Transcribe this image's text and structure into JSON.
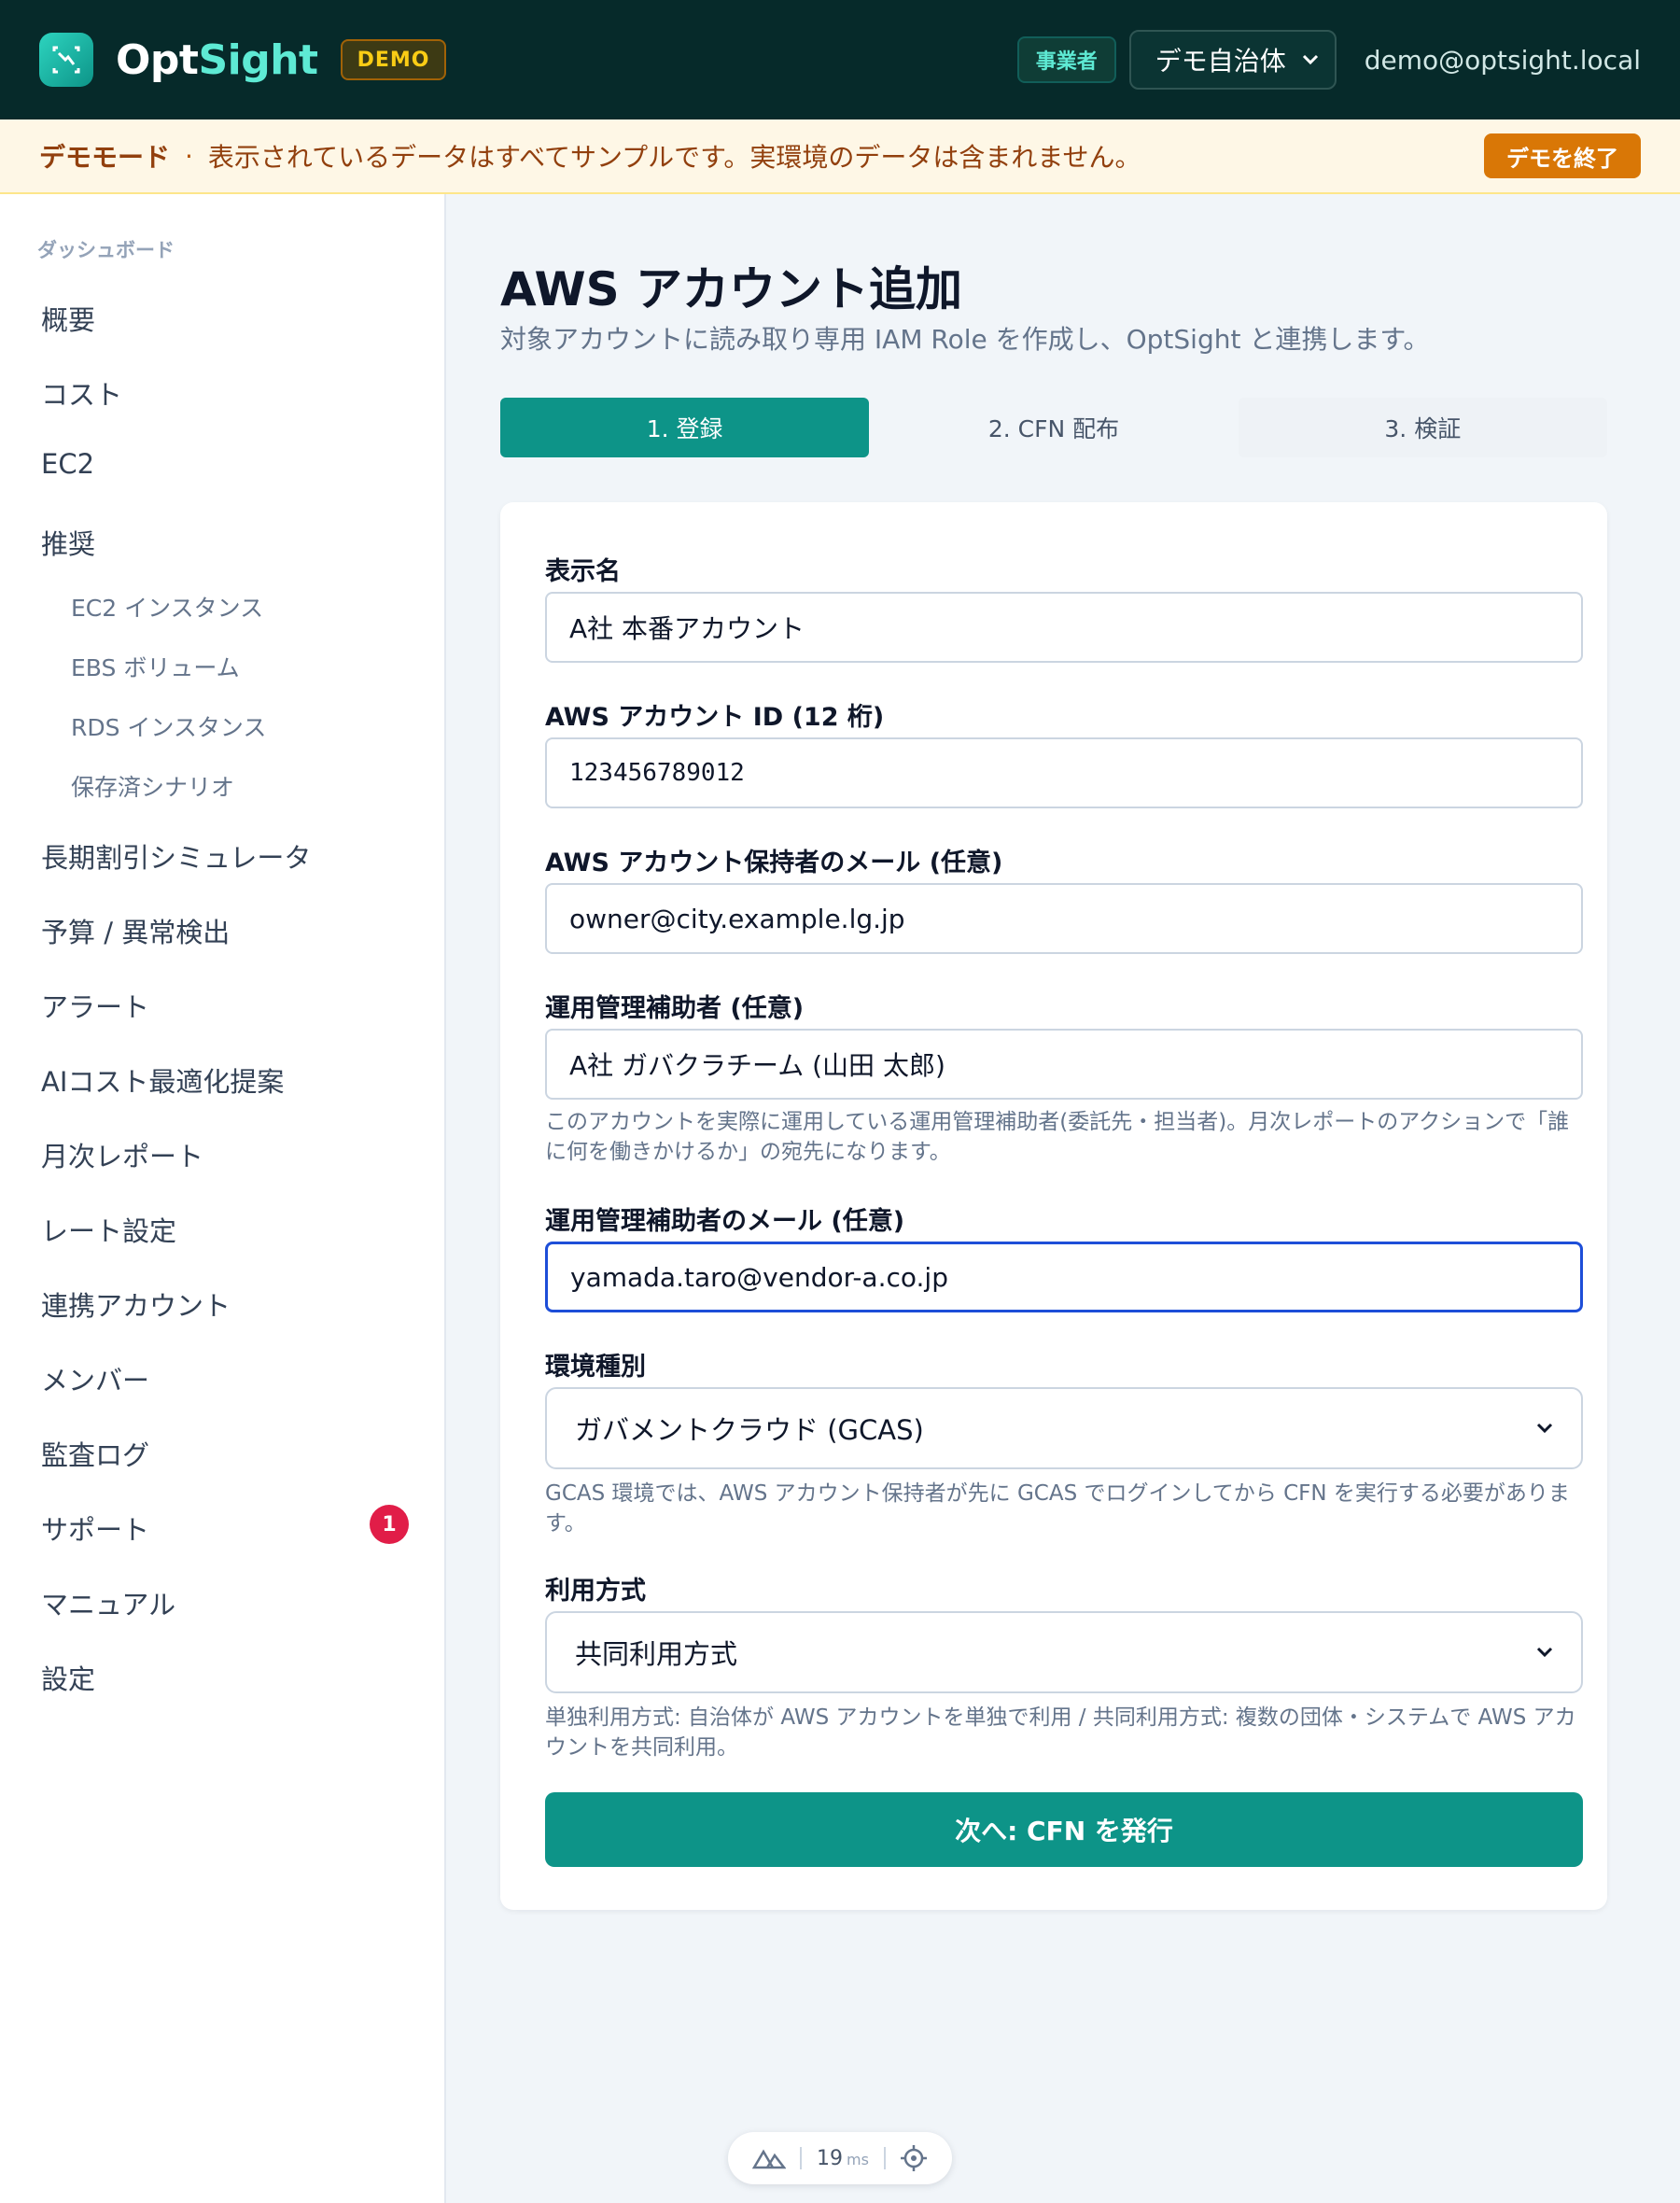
{
  "header": {
    "brand_prefix": "Opt",
    "brand_accent": "Sight",
    "demo_badge": "DEMO",
    "role_badge": "事業者",
    "tenant_selected": "デモ自治体",
    "user_email": "demo@optsight.local"
  },
  "banner": {
    "title": "デモモード",
    "separator": "·",
    "text": "表示されているデータはすべてサンプルです。実環境のデータは含まれません。",
    "exit_label": "デモを終了"
  },
  "sidebar": {
    "section_label": "ダッシュボード",
    "items": [
      {
        "label": "概要"
      },
      {
        "label": "コスト"
      },
      {
        "label": "EC2"
      },
      {
        "label": "推奨"
      },
      {
        "label": "EC2 インスタンス"
      },
      {
        "label": "EBS ボリューム"
      },
      {
        "label": "RDS インスタンス"
      },
      {
        "label": "保存済シナリオ"
      },
      {
        "label": "長期割引シミュレータ"
      },
      {
        "label": "予算 / 異常検出"
      },
      {
        "label": "アラート"
      },
      {
        "label": "AIコスト最適化提案"
      },
      {
        "label": "月次レポート"
      },
      {
        "label": "レート設定"
      },
      {
        "label": "連携アカウント"
      },
      {
        "label": "メンバー"
      },
      {
        "label": "監査ログ"
      },
      {
        "label": "サポート",
        "badge": "1"
      },
      {
        "label": "マニュアル"
      },
      {
        "label": "設定"
      }
    ]
  },
  "page": {
    "title": "AWS アカウント追加",
    "subtitle": "対象アカウントに読み取り専用 IAM Role を作成し、OptSight と連携します。",
    "steps": [
      "1. 登録",
      "2. CFN 配布",
      "3. 検証"
    ]
  },
  "form": {
    "display_name": {
      "label": "表示名",
      "value": "A社 本番アカウント"
    },
    "account_id": {
      "label": "AWS アカウント ID (12 桁)",
      "value": "123456789012"
    },
    "owner_email": {
      "label": "AWS アカウント保持者のメール (任意)",
      "value": "owner@city.example.lg.jp"
    },
    "operator": {
      "label": "運用管理補助者 (任意)",
      "value": "A社 ガバクラチーム (山田 太郎)",
      "hint": "このアカウントを実際に運用している運用管理補助者(委託先・担当者)。月次レポートのアクションで「誰に何を働きかけるか」の宛先になります。"
    },
    "operator_email": {
      "label": "運用管理補助者のメール (任意)",
      "value": "yamada.taro@vendor-a.co.jp"
    },
    "environment": {
      "label": "環境種別",
      "value": "ガバメントクラウド (GCAS)",
      "hint": "GCAS 環境では、AWS アカウント保持者が先に GCAS でログインしてから CFN を実行する必要があります。"
    },
    "usage": {
      "label": "利用方式",
      "value": "共同利用方式",
      "hint": "単独利用方式: 自治体が AWS アカウントを単独で利用 / 共同利用方式: 複数の団体・システムで AWS アカウントを共同利用。"
    },
    "submit_label": "次へ: CFN を発行"
  },
  "devtools": {
    "time": "19",
    "unit": "ms"
  },
  "colors": {
    "brand": "#0d9488",
    "header_bg": "#062a2a",
    "banner_bg": "#fef7e6",
    "focus": "#1d4ed8"
  }
}
